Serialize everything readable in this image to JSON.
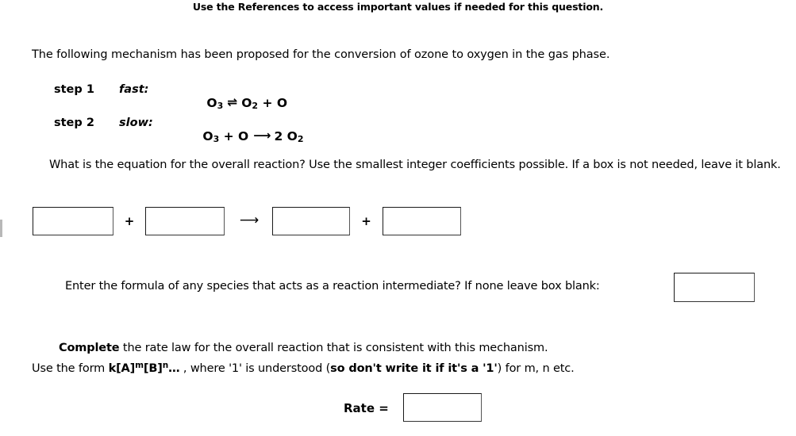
{
  "header": {
    "note": "Use the References to access important values if needed for this question."
  },
  "intro": {
    "text": "The following mechanism has been proposed for the conversion of ozone to oxygen in the gas phase."
  },
  "mechanism": {
    "steps": [
      {
        "label": "step 1",
        "speed": "fast:",
        "reactant_formula": "O",
        "reactant_sub": "3",
        "arrow": "⇌",
        "product1_formula": "O",
        "product1_sub": "2",
        "plus": "+",
        "product2_formula": "O",
        "equation_plain": "O3 ⇌ O2 + O"
      },
      {
        "label": "step 2",
        "speed": "slow:",
        "reactant_formula": "O",
        "reactant_sub": "3",
        "plus": "+",
        "reactant2_formula": "O",
        "arrow": "⟶",
        "product_coefficient": "2",
        "product_formula": "O",
        "product_sub": "2",
        "equation_plain": "O3 + O ⟶ 2 O2"
      }
    ]
  },
  "overall_question": {
    "text": "What is the equation for the overall reaction? Use the smallest integer coefficients possible. If a box is not needed, leave it blank."
  },
  "equation_answer": {
    "boxes": [
      {
        "name": "reactant-1",
        "value": "",
        "placeholder": ""
      },
      {
        "name": "reactant-2",
        "value": "",
        "placeholder": ""
      },
      {
        "name": "product-1",
        "value": "",
        "placeholder": ""
      },
      {
        "name": "product-2",
        "value": "",
        "placeholder": ""
      }
    ],
    "plus_1": "+",
    "arrow": "⟶",
    "plus_2": "+"
  },
  "intermediate_question": {
    "text": "Enter the formula of any species that acts as a reaction intermediate? If none leave box blank:",
    "box": {
      "value": "",
      "placeholder": ""
    }
  },
  "rate_law": {
    "line1_bold": "Complete",
    "line1_rest": " the rate law for the overall reaction that is consistent with this mechanism.",
    "line2_prefix": "Use the form ",
    "formula_k": "k[A]",
    "formula_m": "m",
    "formula_b": "[B]",
    "formula_n": "n",
    "formula_ellipsis": "…",
    "line2_mid": " , where '1' is understood (",
    "line2_bold": "so don't write it if it's a '1'",
    "line2_suffix": ") for m, n etc.",
    "rate_label": "Rate =",
    "rate_box": {
      "value": "",
      "placeholder": ""
    }
  },
  "colors": {
    "background": "#ffffff",
    "text": "#000000",
    "box_border": "#1a1a1a"
  }
}
